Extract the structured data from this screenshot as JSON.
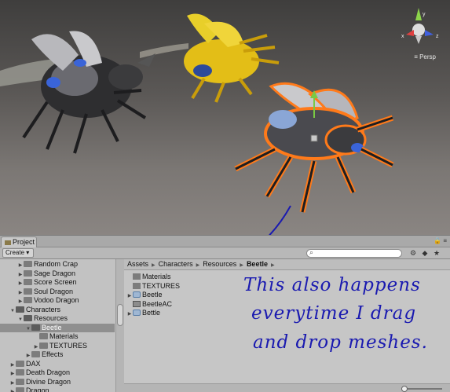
{
  "scene": {
    "view_mode": "Persp",
    "gizmo_axes": [
      "y",
      "x",
      "z"
    ]
  },
  "project": {
    "tab_label": "Project",
    "create_label": "Create",
    "tree": [
      {
        "label": "Random Crap",
        "depth": 1,
        "expanded": false
      },
      {
        "label": "Sage Dragon",
        "depth": 1,
        "expanded": false
      },
      {
        "label": "Score Screen",
        "depth": 1,
        "expanded": false
      },
      {
        "label": "Soul Dragon",
        "depth": 1,
        "expanded": false
      },
      {
        "label": "Vodoo Dragon",
        "depth": 1,
        "expanded": false
      },
      {
        "label": "Characters",
        "depth": 0,
        "expanded": true
      },
      {
        "label": "Resources",
        "depth": 1,
        "expanded": true
      },
      {
        "label": "Beetle",
        "depth": 2,
        "expanded": true,
        "selected": true
      },
      {
        "label": "Materials",
        "depth": 3,
        "expanded": false,
        "leaf": true
      },
      {
        "label": "TEXTURES",
        "depth": 3,
        "expanded": false
      },
      {
        "label": "Effects",
        "depth": 2,
        "expanded": false
      },
      {
        "label": "DAX",
        "depth": 0,
        "expanded": false
      },
      {
        "label": "Death Dragon",
        "depth": 0,
        "expanded": false
      },
      {
        "label": "Divine Dragon",
        "depth": 0,
        "expanded": false
      },
      {
        "label": "Dragon",
        "depth": 0,
        "expanded": false
      }
    ],
    "breadcrumbs": [
      "Assets",
      "Characters",
      "Resources",
      "Beetle"
    ],
    "assets": [
      {
        "label": "Materials",
        "icon": "folder-icon",
        "expandable": false
      },
      {
        "label": "TEXTURES",
        "icon": "folder-icon",
        "expandable": false
      },
      {
        "label": "Beetle",
        "icon": "mesh-icon",
        "expandable": true
      },
      {
        "label": "BeetleAC",
        "icon": "animator-icon",
        "expandable": false
      },
      {
        "label": "Bettle",
        "icon": "mesh-icon",
        "expandable": true
      }
    ]
  },
  "annotation": {
    "line1": "This also happens",
    "line2": "everytime  I  drag",
    "line3": "and drop meshes."
  }
}
